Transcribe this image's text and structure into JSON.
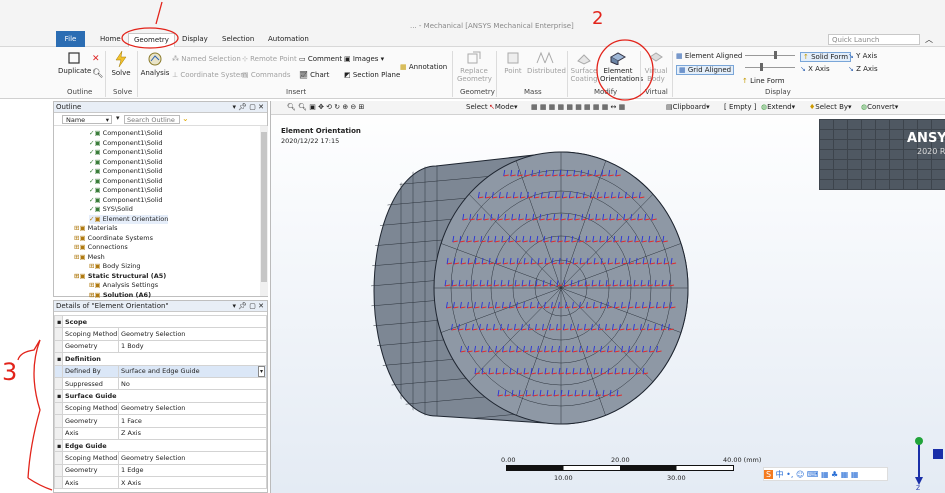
{
  "window": {
    "title": "... - Mechanical [ANSYS Mechanical Enterprise]",
    "quick_launch": "Quick Launch"
  },
  "tabs": [
    "File",
    "Home",
    "Geometry",
    "Display",
    "Selection",
    "Automation"
  ],
  "ribbon": {
    "outline": {
      "duplicate": "Duplicate",
      "group": "Outline"
    },
    "solve": {
      "label": "Solve",
      "group": "Solve"
    },
    "insert": {
      "analysis": "Analysis",
      "named_selection": "Named Selection",
      "remote_point": "Remote Point",
      "comment": "Comment",
      "images": "Images",
      "coordinate_system": "Coordinate System",
      "commands": "Commands",
      "chart": "Chart",
      "section_plane": "Section Plane",
      "annotation": "Annotation",
      "group": "Insert"
    },
    "geometry": {
      "replace_geometry": "Replace Geometry",
      "group": "Geometry"
    },
    "mass": {
      "point": "Point",
      "distributed": "Distributed",
      "group": "Mass"
    },
    "modify": {
      "surface_coating": "Surface Coating",
      "element_orientations": "Element Orientations",
      "group": "Modify"
    },
    "virtual": {
      "virtual_body": "Virtual Body",
      "group": "Virtual"
    },
    "display": {
      "element_aligned": "Element Aligned",
      "grid_aligned": "Grid Aligned",
      "line_form": "Line Form",
      "solid_form": "Solid Form",
      "x_axis": "X Axis",
      "y_axis": "Y Axis",
      "z_axis": "Z Axis",
      "group": "Display"
    }
  },
  "outline": {
    "title": "Outline",
    "name_label": "Name",
    "search_placeholder": "Search Outline",
    "items": [
      {
        "label": "Component1\\Solid",
        "bold": false
      },
      {
        "label": "Component1\\Solid",
        "bold": false
      },
      {
        "label": "Component1\\Solid",
        "bold": false
      },
      {
        "label": "Component1\\Solid",
        "bold": false
      },
      {
        "label": "Component1\\Solid",
        "bold": false
      },
      {
        "label": "Component1\\Solid",
        "bold": false
      },
      {
        "label": "Component1\\Solid",
        "bold": false
      },
      {
        "label": "Component1\\Solid",
        "bold": false
      },
      {
        "label": "SYS\\Solid",
        "bold": false
      },
      {
        "label": "Element Orientation",
        "bold": false,
        "selected": true
      },
      {
        "label": "Materials",
        "bold": false
      },
      {
        "label": "Coordinate Systems",
        "bold": false
      },
      {
        "label": "Connections",
        "bold": false
      },
      {
        "label": "Mesh",
        "bold": false
      },
      {
        "label": "Body Sizing",
        "bold": false
      },
      {
        "label": "Static Structural (A5)",
        "bold": true
      },
      {
        "label": "Analysis Settings",
        "bold": false
      },
      {
        "label": "Solution (A6)",
        "bold": true
      },
      {
        "label": "Solution Information",
        "bold": false
      }
    ]
  },
  "details": {
    "title": "Details of \"Element Orientation\"",
    "rows": [
      {
        "type": "section",
        "label": "Scope"
      },
      {
        "label": "Scoping Method",
        "value": "Geometry Selection"
      },
      {
        "label": "Geometry",
        "value": "1 Body"
      },
      {
        "type": "section",
        "label": "Definition"
      },
      {
        "label": "Defined By",
        "value": "Surface and Edge Guide",
        "highlight": true
      },
      {
        "label": "Suppressed",
        "value": "No"
      },
      {
        "type": "section",
        "label": "Surface Guide"
      },
      {
        "label": "Scoping Method",
        "value": "Geometry Selection"
      },
      {
        "label": "Geometry",
        "value": "1 Face"
      },
      {
        "label": "Axis",
        "value": "Z Axis"
      },
      {
        "type": "section",
        "label": "Edge Guide"
      },
      {
        "label": "Scoping Method",
        "value": "Geometry Selection"
      },
      {
        "label": "Geometry",
        "value": "1 Edge"
      },
      {
        "label": "Axis",
        "value": "X Axis"
      }
    ]
  },
  "viewport": {
    "toolbar": {
      "select": "Select",
      "mode": "Mode",
      "clipboard": "Clipboard",
      "empty": "[ Empty ]",
      "extend": "Extend",
      "select_by": "Select By",
      "convert": "Convert"
    },
    "annotation_title": "Element Orientation",
    "annotation_date": "2020/12/22 17:15",
    "logo": "ANSYS",
    "logo_version": "2020 R",
    "scale": {
      "top": [
        "0.00",
        "20.00",
        "40.00 (mm)"
      ],
      "bottom": [
        "10.00",
        "30.00"
      ]
    },
    "triad_label": "Z"
  },
  "annotations": {
    "mark1": "1",
    "mark2": "2",
    "mark3": "3"
  },
  "colors": {
    "file_tab": "#2b6db3",
    "highlight_red": "#e2231a",
    "mesh_face": "#7b8796",
    "mesh_lines": "#2e3440"
  }
}
